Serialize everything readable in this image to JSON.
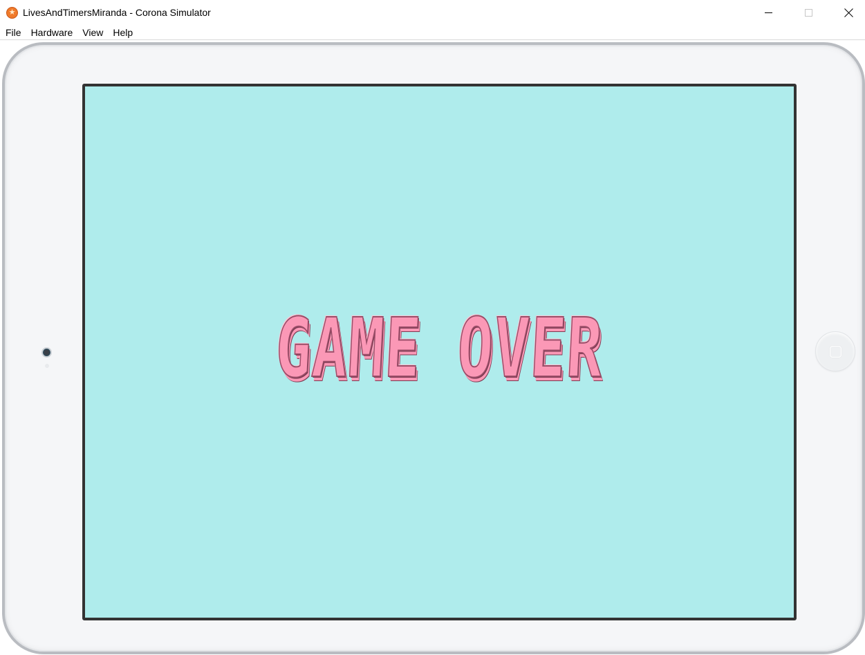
{
  "window": {
    "title": "LivesAndTimersMiranda - Corona Simulator",
    "app_icon": "corona-star-icon",
    "controls": {
      "minimize": "minimize-icon",
      "maximize": "maximize-icon",
      "close": "close-icon"
    }
  },
  "menu": {
    "items": [
      {
        "label": "File"
      },
      {
        "label": "Hardware"
      },
      {
        "label": "View"
      },
      {
        "label": "Help"
      }
    ]
  },
  "device": {
    "type": "tablet",
    "camera_icon": "camera-icon",
    "home_button_icon": "home-button-icon"
  },
  "game": {
    "background_color": "#afecec",
    "message": "GAME OVER",
    "message_color": "#fb98b6"
  }
}
